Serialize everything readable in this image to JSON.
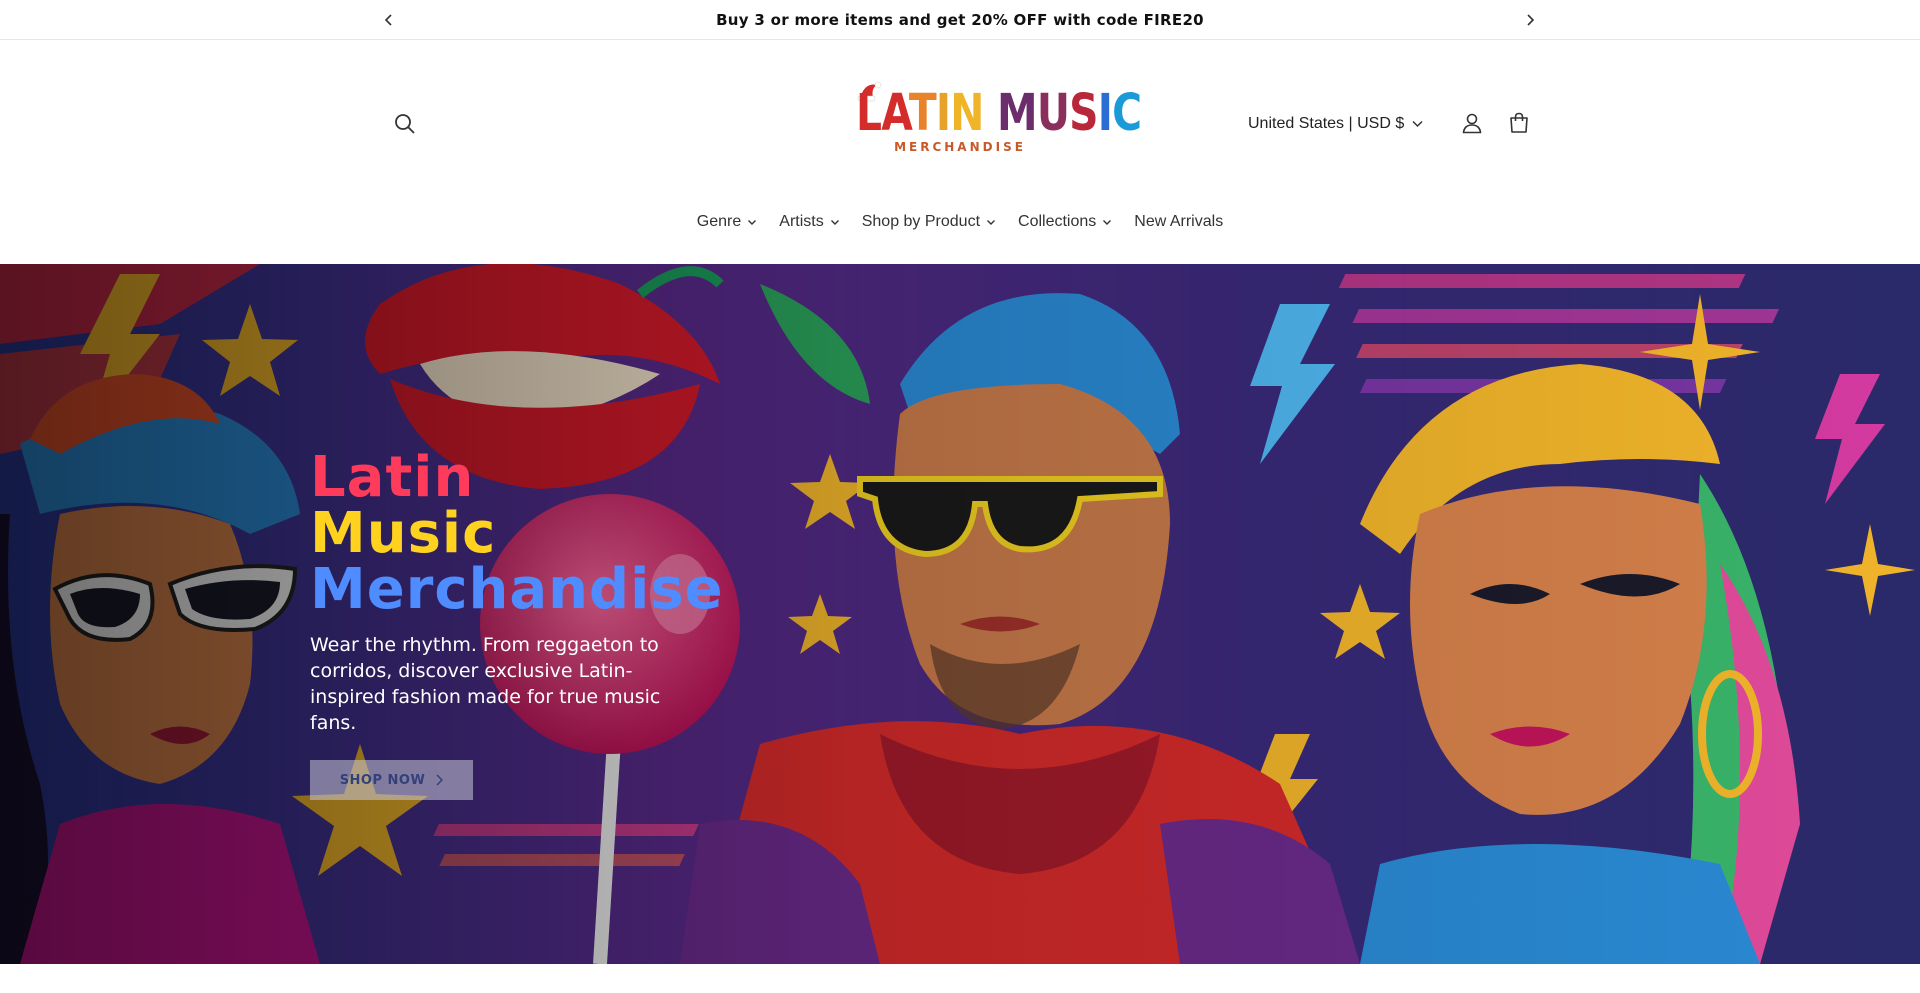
{
  "announcement": {
    "text": "Buy 3 or more items and get 20% OFF with code FIRE20",
    "prev_icon": "chevron-left-icon",
    "next_icon": "chevron-right-icon"
  },
  "header": {
    "logo": {
      "letters": [
        {
          "char": "L",
          "color": "#d42b2b"
        },
        {
          "char": "A",
          "color": "#d42b2b"
        },
        {
          "char": "T",
          "color": "#e8832a"
        },
        {
          "char": "I",
          "color": "#e8a22a"
        },
        {
          "char": "N",
          "color": "#f0b429"
        },
        {
          "char": " ",
          "color": "#000000"
        },
        {
          "char": "M",
          "color": "#6b2d6b"
        },
        {
          "char": "U",
          "color": "#8a2f5c"
        },
        {
          "char": "S",
          "color": "#b8283a"
        },
        {
          "char": "I",
          "color": "#2a6ed4"
        },
        {
          "char": "C",
          "color": "#1a9bd7"
        }
      ],
      "subtitle": "MERCHANDISE"
    },
    "country_selector": "United States | USD $",
    "icons": {
      "search": "search-icon",
      "account": "user-icon",
      "cart": "cart-icon"
    }
  },
  "nav": {
    "items": [
      {
        "label": "Genre",
        "has_dropdown": true
      },
      {
        "label": "Artists",
        "has_dropdown": true
      },
      {
        "label": "Shop by Product",
        "has_dropdown": true
      },
      {
        "label": "Collections",
        "has_dropdown": true
      },
      {
        "label": "New Arrivals",
        "has_dropdown": false
      }
    ]
  },
  "hero": {
    "title_line1": "Latin",
    "title_line2": "Music",
    "title_line3": "Merchandise",
    "subtitle": "Wear the rhythm. From reggaeton to corridos, discover exclusive Latin-inspired fashion made for true music fans.",
    "button_label": "SHOP NOW",
    "colors": {
      "line1": "#ff3b5c",
      "line2": "#ffd21f",
      "line3": "#4f8cff"
    }
  }
}
